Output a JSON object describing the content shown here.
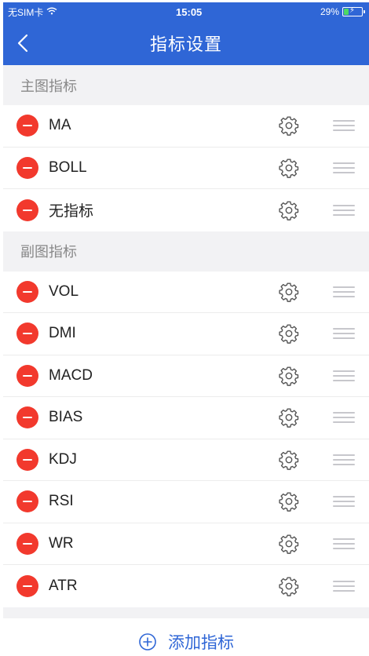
{
  "status_bar": {
    "carrier": "无SIM卡",
    "time": "15:05",
    "battery": "29%",
    "battery_level": 0.29
  },
  "nav": {
    "title": "指标设置",
    "back_icon": "chevron-left-icon"
  },
  "main_section": {
    "title": "主图指标",
    "items": [
      {
        "label": "MA"
      },
      {
        "label": "BOLL"
      },
      {
        "label": "无指标"
      }
    ]
  },
  "sub_section": {
    "title": "副图指标",
    "items": [
      {
        "label": "VOL"
      },
      {
        "label": "DMI"
      },
      {
        "label": "MACD"
      },
      {
        "label": "BIAS"
      },
      {
        "label": "KDJ"
      },
      {
        "label": "RSI"
      },
      {
        "label": "WR"
      },
      {
        "label": "ATR"
      }
    ]
  },
  "add_button": {
    "label": "添加指标"
  },
  "colors": {
    "brand": "#2f66d6",
    "delete": "#f2392d",
    "section_bg": "#f2f2f4"
  }
}
